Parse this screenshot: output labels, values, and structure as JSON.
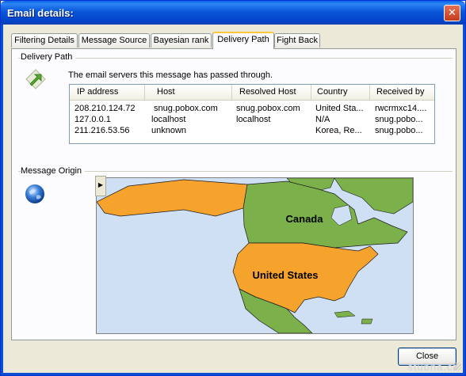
{
  "window": {
    "title": "Email details:",
    "close_glyph": "✕"
  },
  "tabs": [
    {
      "label": "Filtering Details"
    },
    {
      "label": "Message Source"
    },
    {
      "label": "Bayesian rank"
    },
    {
      "label": "Delivery Path"
    },
    {
      "label": "Fight Back"
    }
  ],
  "active_tab": "Delivery Path",
  "delivery_path": {
    "group_label": "Delivery Path",
    "description": "The email servers this message has passed through.",
    "icon": "arrow-in-icon",
    "columns": [
      "IP address",
      "Host",
      "Resolved Host",
      "Country",
      "Received by"
    ],
    "rows": [
      [
        "208.210.124.72",
        " snug.pobox.com",
        "snug.pobox.com",
        "United Sta...",
        "rwcrmxc14...."
      ],
      [
        "127.0.0.1",
        "localhost",
        "localhost",
        "N/A",
        "snug.pobo..."
      ],
      [
        "211.216.53.56",
        "unknown",
        "",
        "Korea, Re...",
        "snug.pobo..."
      ]
    ]
  },
  "message_origin": {
    "group_label": "Message Origin",
    "icon": "globe-icon",
    "map_labels": {
      "canada": "Canada",
      "usa": "United States"
    },
    "colors": {
      "ocean": "#cfe0f5",
      "canada": "#7bb04a",
      "usa": "#f6a32e",
      "alaska": "#f6a32e",
      "other_land": "#7bb04a"
    }
  },
  "buttons": {
    "close": "Close"
  },
  "watermark": "stubna.cz"
}
